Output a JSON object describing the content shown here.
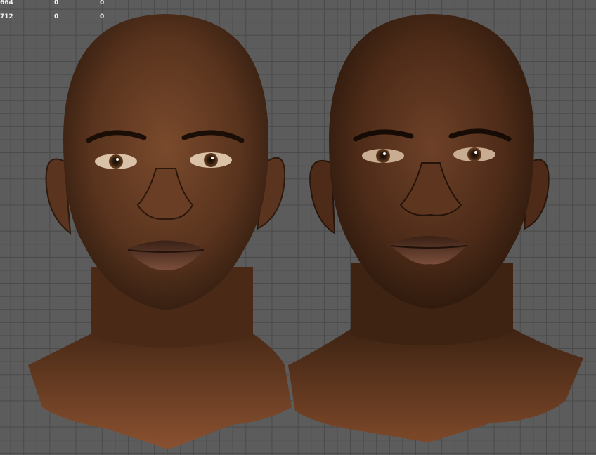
{
  "stats": {
    "rows": [
      [
        "664",
        "0",
        "0"
      ],
      [
        "712",
        "0",
        "0"
      ]
    ]
  },
  "viewport": {
    "background": "#5c5c5c",
    "grid_line": "#4a4a4a"
  },
  "heads": [
    {
      "label_icon": "head-model-front-left",
      "skin": "#5a341e"
    },
    {
      "label_icon": "head-model-front-right",
      "skin": "#4d2b18"
    }
  ]
}
